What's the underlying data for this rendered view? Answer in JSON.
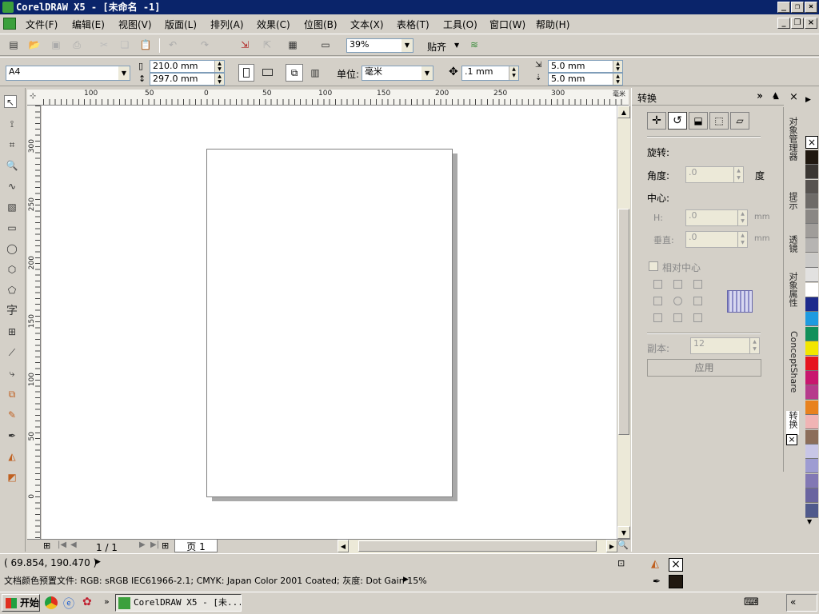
{
  "window": {
    "title": "CorelDRAW X5 - [未命名 -1]"
  },
  "menu": [
    "文件(F)",
    "编辑(E)",
    "视图(V)",
    "版面(L)",
    "排列(A)",
    "效果(C)",
    "位图(B)",
    "文本(X)",
    "表格(T)",
    "工具(O)",
    "窗口(W)",
    "帮助(H)"
  ],
  "toolbar": {
    "zoom": "39%",
    "snap_label": "贴齐"
  },
  "propbar": {
    "page_size": "A4",
    "width": "210.0 mm",
    "height": "297.0 mm",
    "unit_label": "单位:",
    "unit_value": "毫米",
    "nudge": ".1 mm",
    "dup_x": "5.0 mm",
    "dup_y": "5.0 mm"
  },
  "ruler": {
    "top": [
      "100",
      "50",
      "0",
      "50",
      "100",
      "150",
      "200",
      "250",
      "300",
      "毫米"
    ],
    "left": [
      "300",
      "250",
      "200",
      "150",
      "100",
      "50",
      "0"
    ]
  },
  "toolbox": {
    "text_tool": "字"
  },
  "page_nav": {
    "counter": "1 / 1",
    "tab": "页 1"
  },
  "docker": {
    "title": "转换",
    "rotate_label": "旋转:",
    "angle_label": "角度:",
    "angle_value": ".0",
    "angle_unit": "度",
    "center_label": "中心:",
    "h_label": "H:",
    "h_value": ".0",
    "v_label": "垂直:",
    "v_value": ".0",
    "mm1": "mm",
    "mm2": "mm",
    "relative_label": "相对中心",
    "copies_label": "副本:",
    "copies_value": "12",
    "apply": "应用"
  },
  "docker_tabs": [
    "对象管理器",
    "提示",
    "透镜",
    "对象属性",
    "ConceptShare",
    "转换"
  ],
  "status": {
    "coords": "( 69.854, 190.470 )",
    "profile": "文档颜色预置文件: RGB: sRGB IEC61966-2.1; CMYK: Japan Color 2001 Coated; 灰度: Dot Gain 15%"
  },
  "taskbar": {
    "start": "开始",
    "task": "CorelDRAW X5 - [未..."
  },
  "palette": [
    "#201810",
    "#3a3632",
    "#575350",
    "#6e6b68",
    "#8a8784",
    "#a09d9a",
    "#b6b4b2",
    "#cbcac8",
    "#e2e1e0",
    "#ffffff",
    "#1c2a8c",
    "#1e9be0",
    "#11905a",
    "#f2e600",
    "#e6141e",
    "#c8176e",
    "#b63c8c",
    "#e8821e",
    "#f0b4b4",
    "#8c6e5a",
    "#c8c6e6",
    "#9e9cd2",
    "#8278b4",
    "#6a64a0",
    "#505a8c"
  ]
}
